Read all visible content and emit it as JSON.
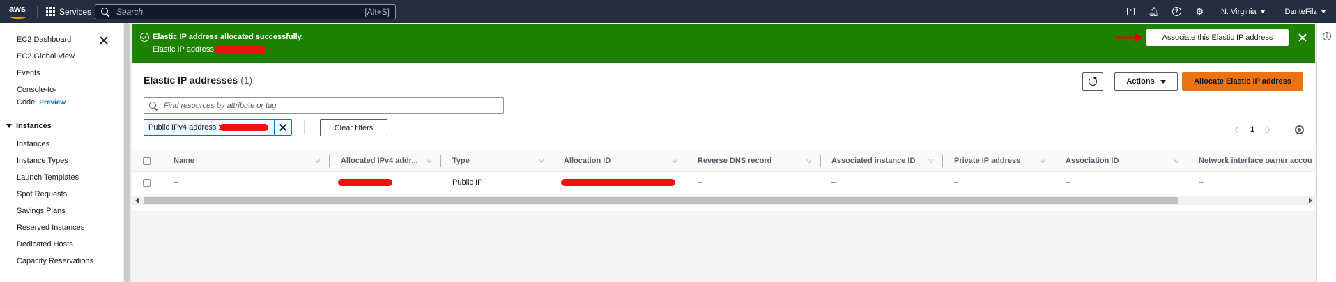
{
  "topnav": {
    "logo": "aws",
    "services_label": "Services",
    "search_placeholder": "Search",
    "search_shortcut": "[Alt+S]",
    "region": "N. Virginia",
    "user": "DanteFilz",
    "icons": [
      "cloudshell-icon",
      "bell-icon",
      "help-icon",
      "settings-icon"
    ]
  },
  "sidebar": {
    "items": [
      {
        "label": "EC2 Dashboard"
      },
      {
        "label": "EC2 Global View"
      },
      {
        "label": "Events"
      },
      {
        "label": "Console-to-"
      },
      {
        "label": "Code"
      },
      {
        "label": "Instances"
      },
      {
        "label": "Instance Types"
      },
      {
        "label": "Launch Templates"
      },
      {
        "label": "Spot Requests"
      },
      {
        "label": "Savings Plans"
      },
      {
        "label": "Reserved Instances"
      },
      {
        "label": "Dedicated Hosts"
      },
      {
        "label": "Capacity Reservations"
      }
    ],
    "preview_badge": "Preview",
    "section_instances": "Instances"
  },
  "flash": {
    "title": "Elastic IP address allocated successfully.",
    "subtitle": "Elastic IP address",
    "action_label": "Associate this Elastic IP address",
    "color": "#1d8102"
  },
  "panel": {
    "title": "Elastic IP addresses",
    "count": "(1)",
    "actions_label": "Actions",
    "allocate_label": "Allocate Elastic IP address",
    "filter_placeholder": "Find resources by attribute or tag",
    "token_label": "Public IPv4 address",
    "clear_filters_label": "Clear filters",
    "page_number": "1",
    "accent": "#ec7211"
  },
  "table": {
    "columns": [
      "Name",
      "Allocated IPv4 addr...",
      "Type",
      "Allocation ID",
      "Reverse DNS record",
      "Associated instance ID",
      "Private IP address",
      "Association ID",
      "Network interface owner accou"
    ],
    "rows": [
      {
        "name": "–",
        "type": "Public IP",
        "reverse_dns": "–",
        "associated_instance": "–",
        "private_ip": "–",
        "association_id": "–",
        "owner": "–"
      }
    ]
  }
}
